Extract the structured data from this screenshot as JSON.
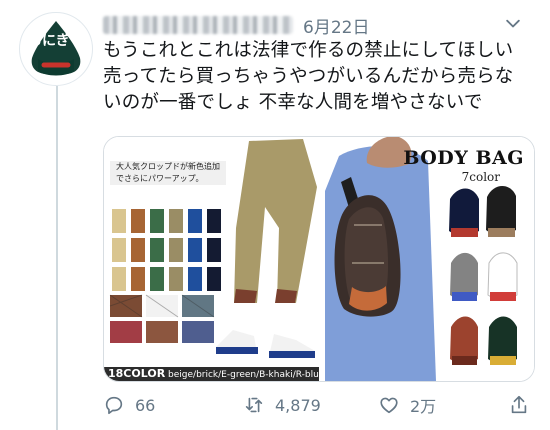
{
  "tweet": {
    "date": "6月22日",
    "text_lines": [
      "もうこれとこれは法律で作るの禁止にしてほしい",
      "売ってたら買っちゃうやつがいるんだから売らな",
      "いのが一番でしょ 不幸な人間を増やさないで"
    ],
    "media": {
      "left_caption": "大人気クロップドが新色追加でさらにパワーアップ。",
      "left_color_count": "18COLOR",
      "left_color_list": " beige/brick/E-green/B-khaki/R-blue/navy ×エスニック・チェック・パ",
      "right_brand": "BODY BAG",
      "right_colors": "7color"
    },
    "stats": {
      "replies": "66",
      "retweets": "4,879",
      "likes": "2万"
    }
  },
  "avatar": {
    "text": "おにぎり"
  },
  "icons": {
    "reply": "reply-icon",
    "retweet": "retweet-icon",
    "like": "heart-icon",
    "share": "share-icon",
    "caret": "chevron-down-icon"
  },
  "colors": {
    "muted": "#657786",
    "text": "#14171a",
    "line": "#cfd9de"
  }
}
